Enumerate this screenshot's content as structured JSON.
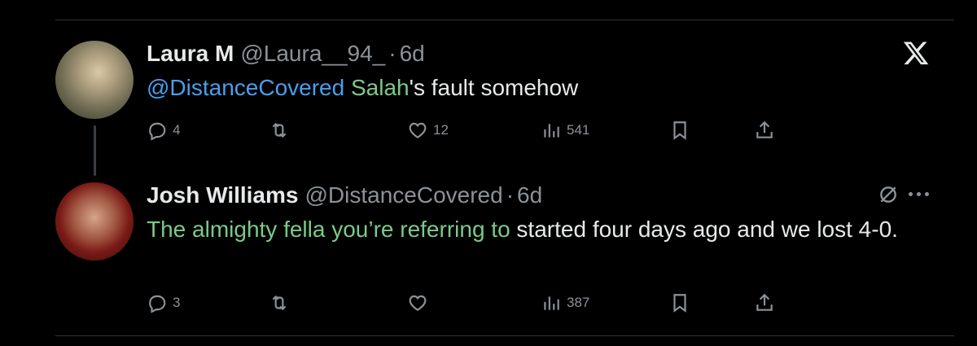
{
  "tweets": [
    {
      "name": "Laura M",
      "handle": "@Laura__94_",
      "dot": "·",
      "time": "6d",
      "text_parts": [
        "@DistanceCovered",
        " ",
        "Salah",
        "'s fault somehow"
      ],
      "actions": {
        "replies": "4",
        "retweets": "",
        "likes": "12",
        "views": "541"
      }
    },
    {
      "name": "Josh Williams",
      "handle": "@DistanceCovered",
      "dot": "·",
      "time": "6d",
      "text_parts": [
        "The almighty fella you’re referring to",
        " started four days ago and we lost 4-0."
      ],
      "actions": {
        "replies": "3",
        "retweets": "",
        "likes": "",
        "views": "387"
      }
    }
  ],
  "icons": {
    "top_right": "x-logo-icon",
    "reply": "reply-icon",
    "retweet": "retweet-icon",
    "like": "heart-icon",
    "views": "views-icon",
    "bookmark": "bookmark-icon",
    "share": "share-icon",
    "grok": "grok-icon",
    "more": "more-icon"
  },
  "colors": {
    "background": "#000000",
    "text": "#e7e9ea",
    "muted": "#8b9297",
    "mention": "#4a9eeb",
    "highlight": "#7cc98a"
  }
}
